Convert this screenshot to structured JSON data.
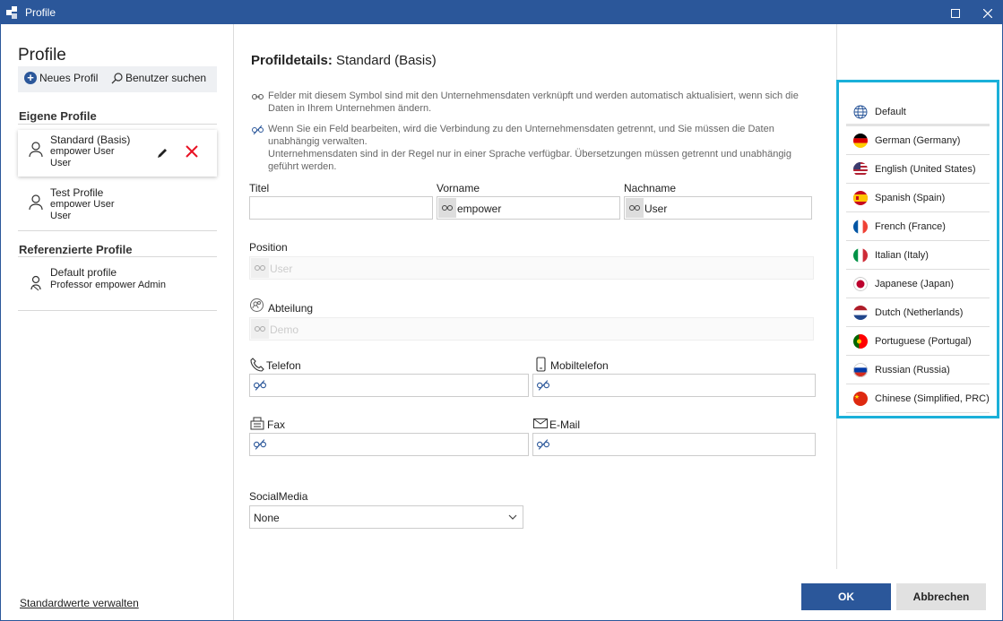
{
  "window": {
    "title": "Profile"
  },
  "sidebar": {
    "title": "Profile",
    "new_profile": "Neues Profil",
    "search_users": "Benutzer suchen",
    "own_profiles_title": "Eigene Profile",
    "own_profiles": [
      {
        "name": "Standard (Basis)",
        "line1": "empower User",
        "line2": "User"
      },
      {
        "name": "Test Profile",
        "line1": "empower User",
        "line2": "User"
      }
    ],
    "referenced_title": "Referenzierte Profile",
    "referenced_profiles": [
      {
        "name": "Default profile",
        "line1": "Professor empower Admin"
      }
    ],
    "manage_defaults": "Standardwerte verwalten"
  },
  "main": {
    "title_bold": "Profildetails:",
    "title_rest": " Standard (Basis)",
    "info1": "Felder mit diesem Symbol sind mit den Unternehmensdaten verknüpft und werden automatisch aktualisiert, wenn sich die Daten in Ihrem Unternehmen ändern.",
    "info2": "Wenn Sie ein Feld bearbeiten, wird die Verbindung zu den Unternehmensdaten getrennt, und Sie müssen die Daten unabhängig verwalten.",
    "info3": "Unternehmensdaten sind in der Regel nur in einer Sprache verfügbar. Übersetzungen müssen getrennt und unabhängig geführt werden.",
    "fields": {
      "titel": {
        "label": "Titel",
        "value": ""
      },
      "vorname": {
        "label": "Vorname",
        "value": "empower"
      },
      "nachname": {
        "label": "Nachname",
        "value": "User"
      },
      "position": {
        "label": "Position",
        "value": "User"
      },
      "abteilung": {
        "label": "Abteilung",
        "value": "Demo"
      },
      "telefon": {
        "label": "Telefon",
        "value": ""
      },
      "mobil": {
        "label": "Mobiltelefon",
        "value": ""
      },
      "fax": {
        "label": "Fax",
        "value": ""
      },
      "email": {
        "label": "E-Mail",
        "value": ""
      },
      "social": {
        "label": "SocialMedia",
        "value": "None"
      }
    }
  },
  "languages": [
    {
      "label": "Default",
      "icon": "globe-icon"
    },
    {
      "label": "German (Germany)",
      "icon": "flag-de-icon"
    },
    {
      "label": "English (United States)",
      "icon": "flag-us-icon"
    },
    {
      "label": "Spanish (Spain)",
      "icon": "flag-es-icon"
    },
    {
      "label": "French (France)",
      "icon": "flag-fr-icon"
    },
    {
      "label": "Italian (Italy)",
      "icon": "flag-it-icon"
    },
    {
      "label": "Japanese (Japan)",
      "icon": "flag-jp-icon"
    },
    {
      "label": "Dutch (Netherlands)",
      "icon": "flag-nl-icon"
    },
    {
      "label": "Portuguese (Portugal)",
      "icon": "flag-pt-icon"
    },
    {
      "label": "Russian (Russia)",
      "icon": "flag-ru-icon"
    },
    {
      "label": "Chinese (Simplified, PRC)",
      "icon": "flag-cn-icon"
    }
  ],
  "buttons": {
    "ok": "OK",
    "cancel": "Abbrechen"
  },
  "colors": {
    "accent": "#2b579a",
    "highlight": "#1ab0d9",
    "delete": "#e81123"
  }
}
